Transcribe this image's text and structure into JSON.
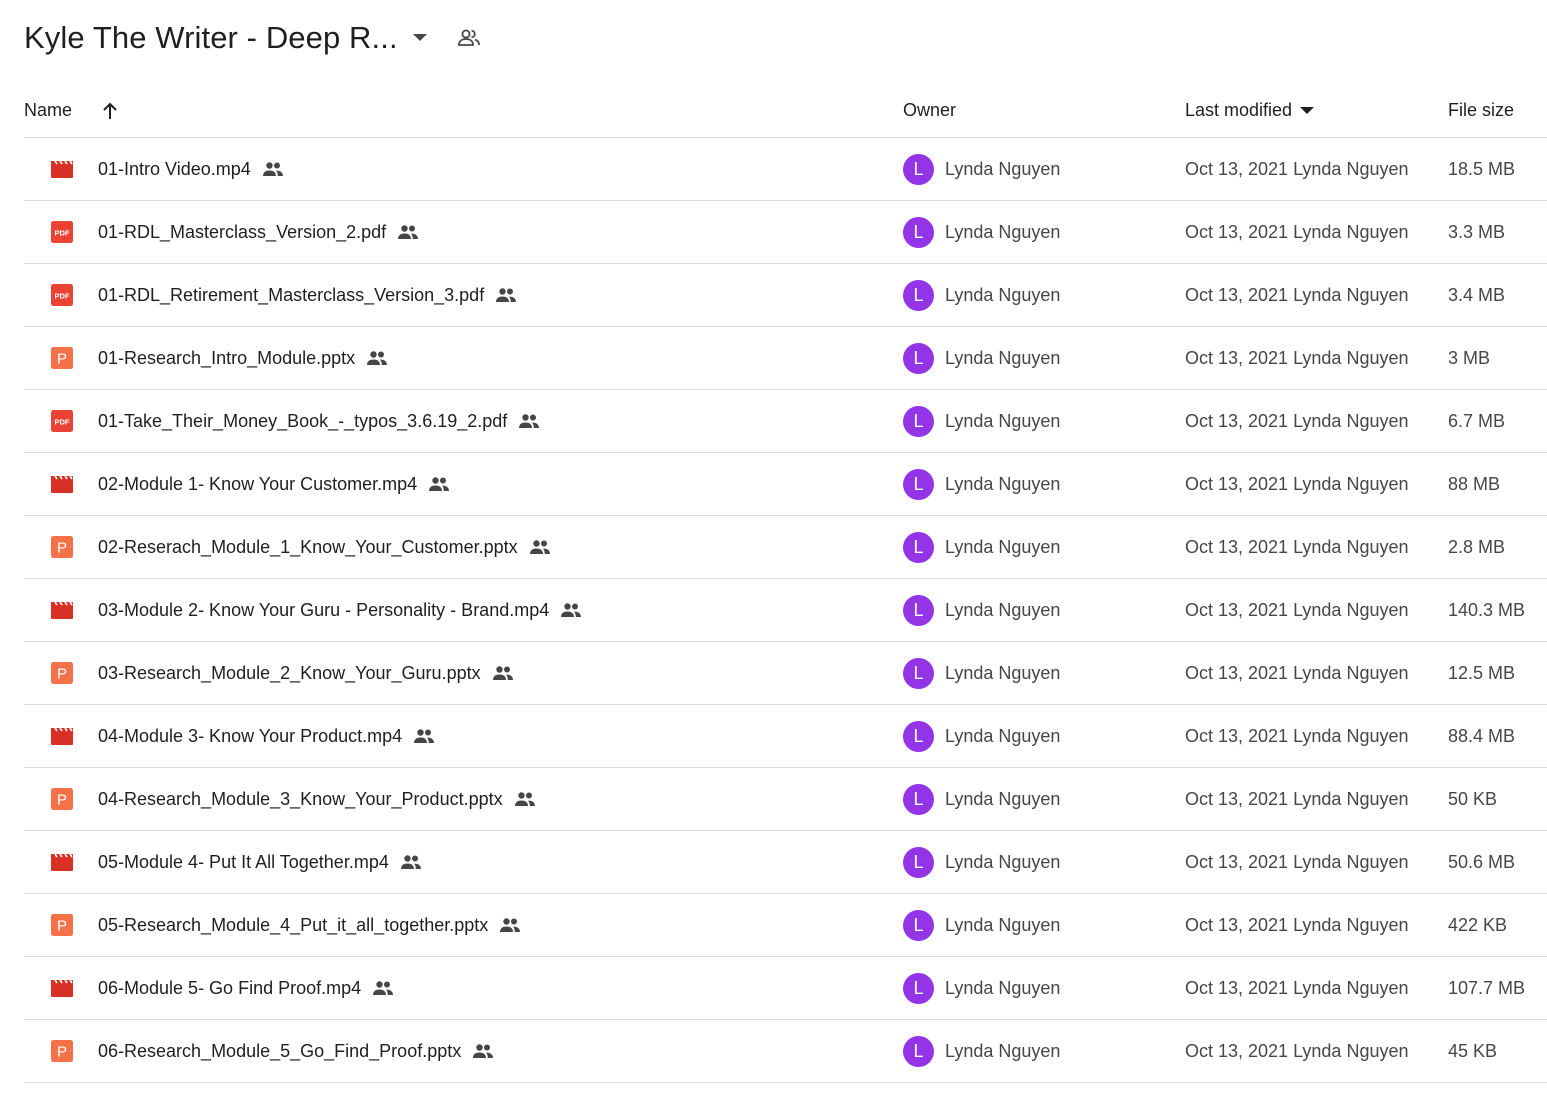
{
  "header": {
    "folder_title": "Kyle The Writer - Deep R...",
    "dropdown_icon": "arrow-drop-down-icon",
    "shared_icon": "shared-folder-people-icon"
  },
  "columns": {
    "name": "Name",
    "owner": "Owner",
    "last_modified": "Last modified",
    "file_size": "File size"
  },
  "colors": {
    "video": "#d93025",
    "pdf": "#ea4335",
    "pptx": "#f4714a",
    "avatar": "#9334e6"
  },
  "files": [
    {
      "type": "video",
      "name": "01-Intro Video.mp4",
      "owner_initial": "L",
      "owner": "Lynda Nguyen",
      "modified": "Oct 13, 2021 Lynda Nguyen",
      "size": "18.5 MB"
    },
    {
      "type": "pdf",
      "name": "01-RDL_Masterclass_Version_2.pdf",
      "owner_initial": "L",
      "owner": "Lynda Nguyen",
      "modified": "Oct 13, 2021 Lynda Nguyen",
      "size": "3.3 MB"
    },
    {
      "type": "pdf",
      "name": "01-RDL_Retirement_Masterclass_Version_3.pdf",
      "owner_initial": "L",
      "owner": "Lynda Nguyen",
      "modified": "Oct 13, 2021 Lynda Nguyen",
      "size": "3.4 MB"
    },
    {
      "type": "pptx",
      "name": "01-Research_Intro_Module.pptx",
      "owner_initial": "L",
      "owner": "Lynda Nguyen",
      "modified": "Oct 13, 2021 Lynda Nguyen",
      "size": "3 MB"
    },
    {
      "type": "pdf",
      "name": "01-Take_Their_Money_Book_-_typos_3.6.19_2.pdf",
      "owner_initial": "L",
      "owner": "Lynda Nguyen",
      "modified": "Oct 13, 2021 Lynda Nguyen",
      "size": "6.7 MB"
    },
    {
      "type": "video",
      "name": "02-Module 1- Know Your Customer.mp4",
      "owner_initial": "L",
      "owner": "Lynda Nguyen",
      "modified": "Oct 13, 2021 Lynda Nguyen",
      "size": "88 MB"
    },
    {
      "type": "pptx",
      "name": "02-Reserach_Module_1_Know_Your_Customer.pptx",
      "owner_initial": "L",
      "owner": "Lynda Nguyen",
      "modified": "Oct 13, 2021 Lynda Nguyen",
      "size": "2.8 MB"
    },
    {
      "type": "video",
      "name": "03-Module 2- Know Your Guru - Personality - Brand.mp4",
      "owner_initial": "L",
      "owner": "Lynda Nguyen",
      "modified": "Oct 13, 2021 Lynda Nguyen",
      "size": "140.3 MB"
    },
    {
      "type": "pptx",
      "name": "03-Research_Module_2_Know_Your_Guru.pptx",
      "owner_initial": "L",
      "owner": "Lynda Nguyen",
      "modified": "Oct 13, 2021 Lynda Nguyen",
      "size": "12.5 MB"
    },
    {
      "type": "video",
      "name": "04-Module 3- Know Your Product.mp4",
      "owner_initial": "L",
      "owner": "Lynda Nguyen",
      "modified": "Oct 13, 2021 Lynda Nguyen",
      "size": "88.4 MB"
    },
    {
      "type": "pptx",
      "name": "04-Research_Module_3_Know_Your_Product.pptx",
      "owner_initial": "L",
      "owner": "Lynda Nguyen",
      "modified": "Oct 13, 2021 Lynda Nguyen",
      "size": "50 KB"
    },
    {
      "type": "video",
      "name": "05-Module 4- Put It All Together.mp4",
      "owner_initial": "L",
      "owner": "Lynda Nguyen",
      "modified": "Oct 13, 2021 Lynda Nguyen",
      "size": "50.6 MB"
    },
    {
      "type": "pptx",
      "name": "05-Research_Module_4_Put_it_all_together.pptx",
      "owner_initial": "L",
      "owner": "Lynda Nguyen",
      "modified": "Oct 13, 2021 Lynda Nguyen",
      "size": "422 KB"
    },
    {
      "type": "video",
      "name": "06-Module 5- Go Find Proof.mp4",
      "owner_initial": "L",
      "owner": "Lynda Nguyen",
      "modified": "Oct 13, 2021 Lynda Nguyen",
      "size": "107.7 MB"
    },
    {
      "type": "pptx",
      "name": "06-Research_Module_5_Go_Find_Proof.pptx",
      "owner_initial": "L",
      "owner": "Lynda Nguyen",
      "modified": "Oct 13, 2021 Lynda Nguyen",
      "size": "45 KB"
    }
  ]
}
